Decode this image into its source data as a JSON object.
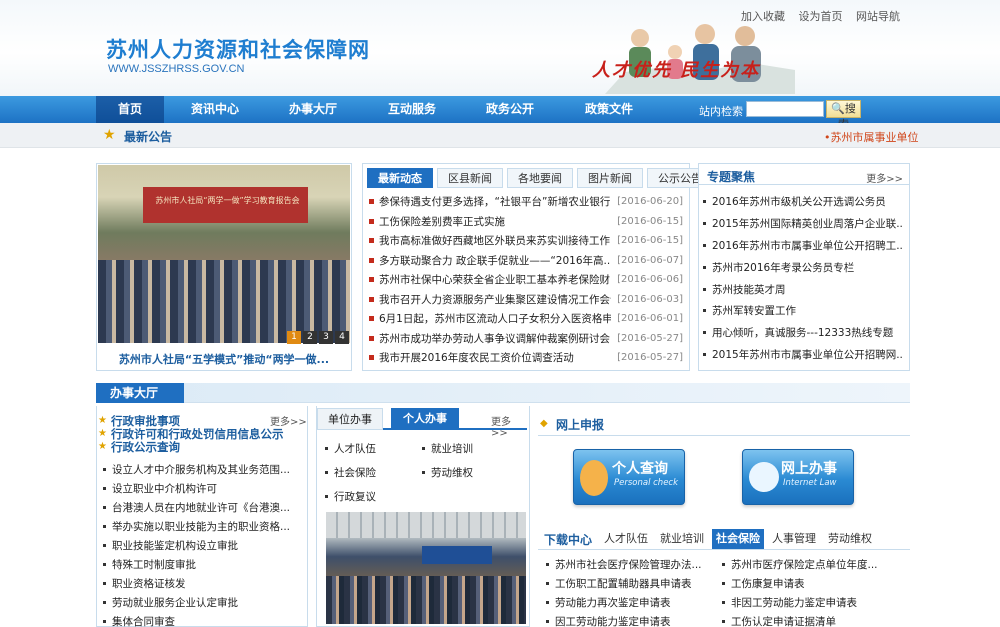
{
  "header": {
    "site_title": "苏州人力资源和社会保障网",
    "site_url": "WWW.JSSZHRSS.GOV.CN",
    "slogan": "人才优先 民生为本",
    "top_links": [
      "加入收藏",
      "设为首页",
      "网站导航"
    ]
  },
  "nav": {
    "items": [
      "首页",
      "资讯中心",
      "办事大厅",
      "互动服务",
      "政务公开",
      "政策文件"
    ],
    "search_label": "站内检索",
    "search_placeholder": "",
    "search_button": "搜索"
  },
  "notice": {
    "label": "最新公告",
    "right_text": "•苏州市属事业单位"
  },
  "slideshow": {
    "stage_text": "苏州市人社局“两学一做”学习教育报告会",
    "pages": [
      "1",
      "2",
      "3",
      "4"
    ],
    "caption": "苏州市人社局“五学模式”推动“两学一做..."
  },
  "news": {
    "tabs": [
      "最新动态",
      "区县新闻",
      "各地要闻",
      "图片新闻",
      "公示公告"
    ],
    "items": [
      {
        "title": "参保待遇支付更多选择，“社银平台”新增农业银行",
        "date": "[2016-06-20]"
      },
      {
        "title": "工伤保险差别费率正式实施",
        "date": "[2016-06-15]"
      },
      {
        "title": "我市高标准做好西藏地区外联员来苏实训接待工作",
        "date": "[2016-06-15]"
      },
      {
        "title": "多方联动聚合力 政企联手促就业——“2016年高...",
        "date": "[2016-06-07]"
      },
      {
        "title": "苏州市社保中心荣获全省企业职工基本养老保险财...",
        "date": "[2016-06-06]"
      },
      {
        "title": "我市召开人力资源服务产业集聚区建设情况工作会议",
        "date": "[2016-06-03]"
      },
      {
        "title": "6月1日起，苏州市区流动人口子女积分入医资格申...",
        "date": "[2016-06-01]"
      },
      {
        "title": "苏州市成功举办劳动人事争议调解仲裁案例研讨会",
        "date": "[2016-05-27]"
      },
      {
        "title": "我市开展2016年度农民工资价位调查活动",
        "date": "[2016-05-27]"
      }
    ]
  },
  "topics": {
    "heading": "专题聚焦",
    "more": "更多>>",
    "items": [
      "2016年苏州市级机关公开选调公务员",
      "2015年苏州国际精英创业周落户企业联...",
      "2016年苏州市市属事业单位公开招聘工...",
      "苏州市2016年考录公务员专栏",
      "苏州技能英才周",
      "苏州军转安置工作",
      "用心倾听，真诚服务---12333热线专题",
      "2015年苏州市市属事业单位公开招聘网..."
    ]
  },
  "hall": {
    "title": "办事大厅",
    "more": "更多>>",
    "heads": [
      "行政审批事项",
      "行政许可和行政处罚信用信息公示",
      "行政公示查询"
    ],
    "items": [
      "设立人才中介服务机构及其业务范围...",
      "设立职业中介机构许可",
      "台港澳人员在内地就业许可《台港澳...",
      "举办实施以职业技能为主的职业资格...",
      "职业技能鉴定机构设立审批",
      "特殊工时制度审批",
      "职业资格证核发",
      "劳动就业服务企业认定审批",
      "集体合同审查"
    ]
  },
  "services": {
    "tabs": [
      "单位办事",
      "个人办事"
    ],
    "more": "更多>>",
    "items": [
      "人才队伍",
      "就业培训",
      "社会保险",
      "劳动维权",
      "行政复议"
    ]
  },
  "online": {
    "heading": "网上申报",
    "btn1_cn": "个人查询",
    "btn1_en": "Personal check",
    "btn2_cn": "网上办事",
    "btn2_en": "Internet Law"
  },
  "downloads": {
    "heading": "下载中心",
    "tabs": [
      "人才队伍",
      "就业培训",
      "社会保险",
      "人事管理",
      "劳动维权"
    ],
    "items": [
      "苏州市社会医疗保险管理办法...",
      "苏州市医疗保险定点单位年度...",
      "工伤职工配置辅助器具申请表",
      "工伤康复申请表",
      "劳动能力再次鉴定申请表",
      "非因工劳动能力鉴定申请表",
      "因工劳动能力鉴定申请表",
      "工伤认定申请证据清单"
    ]
  },
  "colors": {
    "accent": "#1f6fc1",
    "red": "#c42b1c",
    "gold": "#e0a300"
  }
}
